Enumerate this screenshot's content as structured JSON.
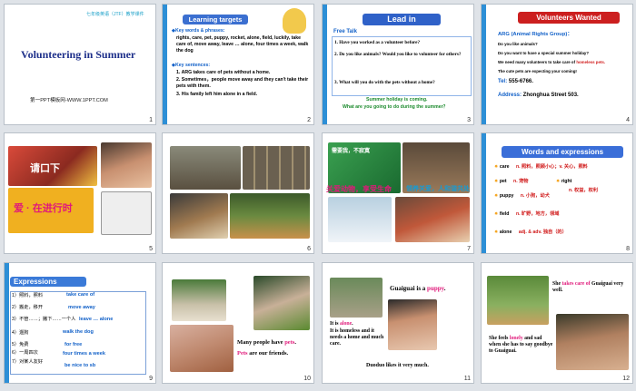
{
  "slides": [
    {
      "n": "1",
      "header": "七年级英语（JTF）教学课件",
      "title": "Volunteering  in Summer",
      "footer": "第一PPT模板网-WWW.1PPT.COM"
    },
    {
      "n": "2",
      "title": "Learning targets",
      "words_heading": "Key words & phrases:",
      "words": "rights, care, pet, puppy, rocket, alone, field, luckily, take care of, move away, leave … alone, four times a week, walk the dog",
      "sent_heading": "Key sentences:",
      "s1": "1. ARG takes care of pets without a home.",
      "s2": "2. Sometimes，people move away and they can't take their pets with them.",
      "s3": "3. His family left him alone in a field."
    },
    {
      "n": "3",
      "title": "Lead in",
      "sub": "Free Talk",
      "q1": "1. Have you worked as a volunteer before?",
      "q2": "2. Do you like animals? Would you like to volunteer for others?",
      "q3": "3. What will you do with the pets without a home?",
      "note1": "Summer holiday is coming.",
      "note2": "What are you going to do during the summer？"
    },
    {
      "n": "4",
      "title": "Volunteers Wanted",
      "l1": "ARG (Animal Rights Group)：",
      "l2": "Do you like animals?",
      "l3": "Do you want to have a special summer holiday?",
      "l4a": "We need many volunteers to take care of ",
      "l4b": "homeless pets.",
      "l5": "The cute pets are expecting your coming!",
      "tel_label": "Tel:",
      "tel": " 555-6766.",
      "addr_label": "Address:",
      "addr": " Zhonghua Street 503."
    },
    {
      "n": "5",
      "sign1": "请口下",
      "sign2": "爱 · 在进行时"
    },
    {
      "n": "6"
    },
    {
      "n": "7",
      "caption1": "需要我，不寂寞",
      "caption2": "关爱动物，享受生命",
      "caption3": "领养关爱，人和谐共处"
    },
    {
      "n": "8",
      "title": "Words and expressions",
      "rows": [
        {
          "word": "care",
          "def": "n. 照料，照顾小心；v. 关心，照料"
        },
        {
          "word": "pet",
          "def": "n. 宠物"
        },
        {
          "word": "right",
          "def": "n. 权益，权利"
        },
        {
          "word": "puppy",
          "def": "n. 小狗，幼犬"
        },
        {
          "word": "field",
          "def": "n. 旷野，地方，领域"
        },
        {
          "word": "alone",
          "def": "adj. & adv. 独自（的）"
        }
      ]
    },
    {
      "n": "9",
      "title": "Expressions",
      "items": [
        {
          "cn": "1）照料，照料",
          "en": "take care of"
        },
        {
          "cn": "2）搬走，移开",
          "en": "move away"
        },
        {
          "cn": "3）不管……；撇下……一个人",
          "en": "leave … alone"
        },
        {
          "cn": "4）遛狗",
          "en": "walk the dog"
        },
        {
          "cn": "5）免费",
          "en": "for free"
        },
        {
          "cn": "6）一周四次",
          "en": "four times a week"
        },
        {
          "cn": "7）对某人友好",
          "en": "be nice to sb"
        }
      ]
    },
    {
      "n": "10",
      "t1a": "Many people have ",
      "t1b": "pets",
      "t1c": ".",
      "t2a": "Pets",
      "t2b": " are our friends."
    },
    {
      "n": "11",
      "t1a": "Guaiguai is a ",
      "t1b": "puppy",
      "t1c": ".",
      "t2a": "It is ",
      "t2b": "alone",
      "t2c": ".",
      "t3": "It is homeless and it needs a home and much care.",
      "t4": "Duoduo  likes it very  much."
    },
    {
      "n": "12",
      "t1a": "She ",
      "t1b": "takes care of",
      "t1c": " Guaiguai very well.",
      "t2a": "She feels ",
      "t2b": "lonely",
      "t2c": " and sad when she has to say goodbye to Guaiguai."
    }
  ]
}
